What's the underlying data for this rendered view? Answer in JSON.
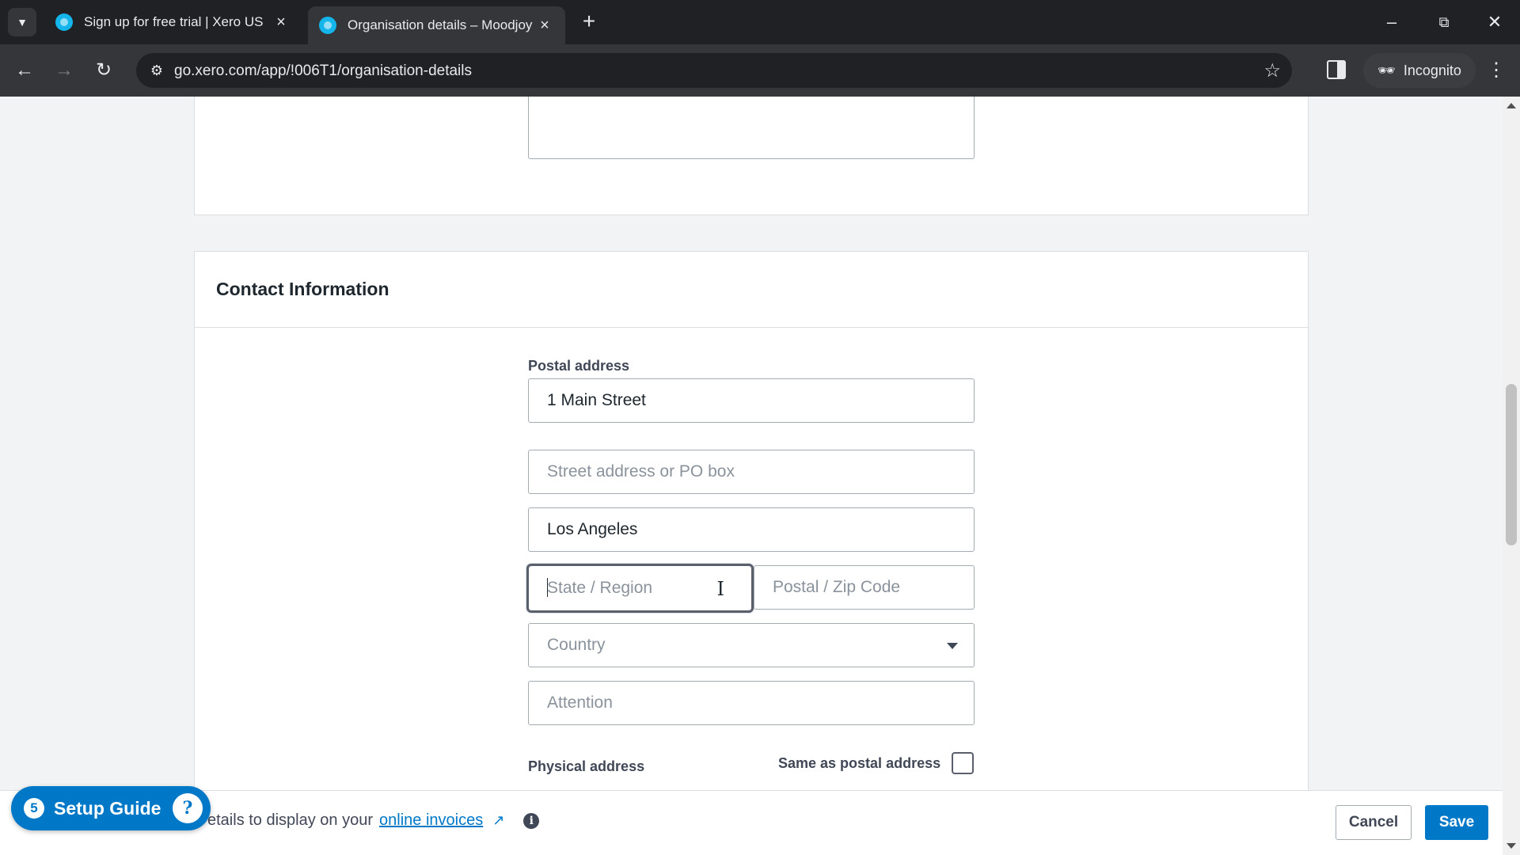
{
  "browser": {
    "tabs": [
      {
        "title": "Sign up for free trial | Xero US",
        "active": false
      },
      {
        "title": "Organisation details – Moodjoy",
        "active": true
      }
    ],
    "new_tab_symbol": "+",
    "url": "go.xero.com/app/!006T1/organisation-details",
    "profile_label": "Incognito"
  },
  "contact": {
    "section_title": "Contact Information",
    "postal_label": "Postal address",
    "address_line1": {
      "value": "1 Main Street"
    },
    "address_line2": {
      "placeholder": "Street address or PO box"
    },
    "city": {
      "value": "Los Angeles"
    },
    "state": {
      "placeholder": "State / Region"
    },
    "postal_code": {
      "placeholder": "Postal / Zip Code"
    },
    "country": {
      "placeholder": "Country"
    },
    "attention": {
      "placeholder": "Attention"
    },
    "physical_label": "Physical address",
    "same_as_postal_label": "Same as postal address",
    "same_as_postal_checked": false
  },
  "footer": {
    "note_prefix": "etails to display on your",
    "note_link": "online invoices",
    "cancel_label": "Cancel",
    "save_label": "Save"
  },
  "setup_guide": {
    "count": "5",
    "label": "Setup Guide"
  },
  "colors": {
    "brand_blue": "#0078c8",
    "xero_favicon": "#13b5ea"
  },
  "icons": [
    "tab-list-icon",
    "close-icon",
    "plus-icon",
    "minimize-icon",
    "restore-icon",
    "back-icon",
    "forward-icon",
    "reload-icon",
    "site-settings-icon",
    "star-icon",
    "side-panel-icon",
    "incognito-icon",
    "kebab-menu-icon",
    "external-link-icon",
    "info-icon",
    "help-icon",
    "chevron-down-icon",
    "text-cursor-icon"
  ]
}
